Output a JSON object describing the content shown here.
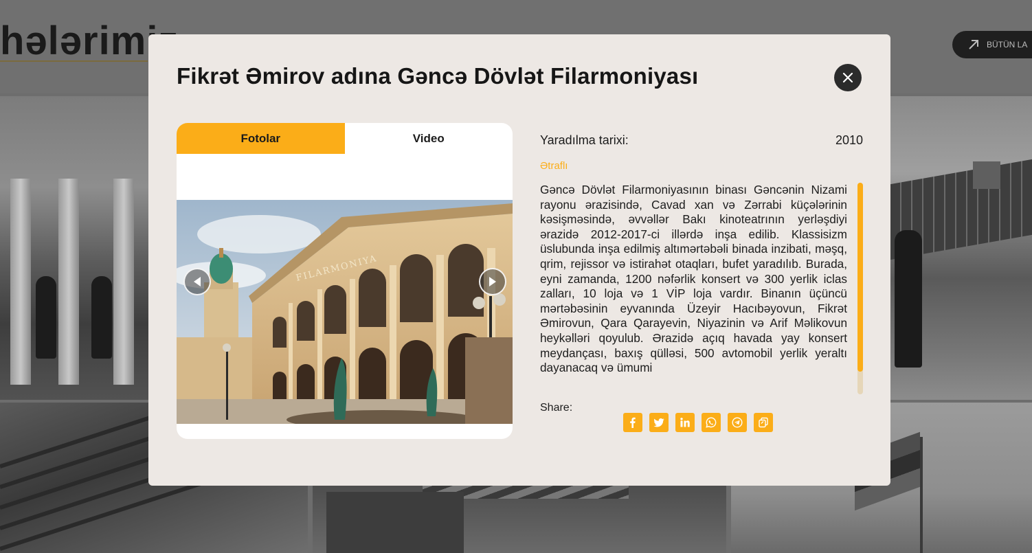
{
  "background": {
    "heading": "hələrimiz",
    "all_button_label": "BÜTÜN LA"
  },
  "modal": {
    "title": "Fikrət Əmirov adına Gəncə Dövlət Filarmoniyası",
    "close_icon": "close-icon",
    "tabs": [
      {
        "label": "Fotolar",
        "active": true
      },
      {
        "label": "Video",
        "active": false
      }
    ],
    "gallery": {
      "prev_icon": "chevron-left-icon",
      "next_icon": "chevron-right-icon",
      "photo_sign": "FILARMONIYA"
    },
    "info": {
      "created_label": "Yaradılma tarixi:",
      "created_value": "2010",
      "more_link": "Ətraflı",
      "description": "Gəncə Dövlət Filarmoniyasının binası Gəncənin Nizami rayonu ərazisində, Cavad xan və Zərrabi küçələrinin kəsişməsində, əvvəllər Bakı kinoteatrının yerləşdiyi ərazidə 2012-2017-ci illərdə inşa edilib. Klassisizm üslubunda inşa edilmiş altımərtəbəli binada inzibati, məşq, qrim, rejissor və istirahət otaqları, bufet yaradılıb. Burada, eyni zamanda, 1200 nəfərlik konsert və 300 yerlik iclas zalları, 10 loja və 1 VİP loja vardır. Binanın üçüncü mərtəbəsinin eyvanında Üzeyir Hacıbəyovun, Fikrət Əmirovun, Qara Qarayevin, Niyazinin və Arif Məlikovun heykəlləri qoyulub. Ərazidə açıq havada yay konsert meydançası, baxış qülləsi, 500 avtomobil yerlik yeraltı dayanacaq və ümumi"
    },
    "share": {
      "label": "Share:",
      "icons": [
        "facebook-icon",
        "twitter-icon",
        "linkedin-icon",
        "whatsapp-icon",
        "telegram-icon",
        "copy-link-icon"
      ]
    },
    "colors": {
      "accent": "#fbad18",
      "modal_bg": "#ede8e4",
      "close_bg": "#2b2b2b"
    }
  }
}
